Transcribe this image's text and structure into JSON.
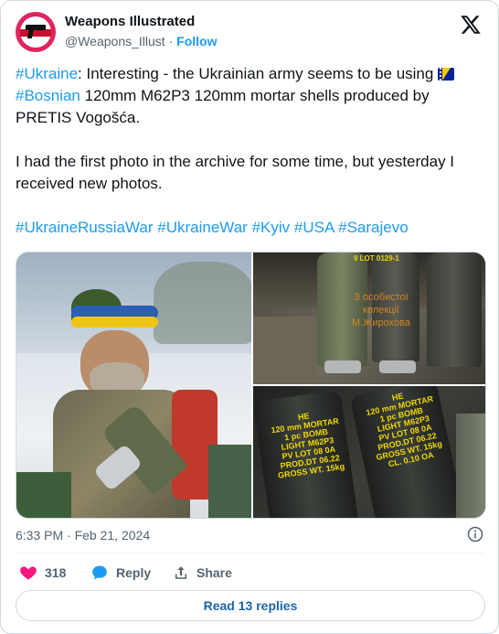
{
  "account": {
    "name": "Weapons Illustrated",
    "handle": "@Weapons_Illust",
    "separator": "·",
    "follow_label": "Follow",
    "avatar_icon": "pistol-logo-icon"
  },
  "brand_icon": "x-logo-icon",
  "tweet": {
    "tag_ukraine": "#Ukraine",
    "line1_rest": ": Interesting - the Ukrainian army seems to be using ",
    "flag_icon": "bosnia-flag-icon",
    "tag_bosnian": "#Bosnian",
    "line1_end": " 120mm M62P3 120mm mortar shells produced by PRETIS Vogošća.",
    "paragraph2": "I had the first photo in the archive for some time, but yesterday I received new photos.",
    "hashtags": [
      "#UkraineRussiaWar",
      "#UkraineWar",
      "#Kyiv",
      "#USA",
      "#Sarajevo"
    ]
  },
  "media": {
    "photo1": "soldier-with-mortar-shell-photo",
    "photo2": {
      "subject": "mortar-shells-photo",
      "watermark": "З особистої\nколекції\nМ.Жирохова",
      "shell_marking": "9 LOT 0129-1"
    },
    "photo3": {
      "subject": "mortar-shell-markings-photo",
      "marking_left": "HE\n120 mm MORTAR\n1 pc BOMB\nLIGHT M62P3\nPV LOT 08 0A\nPROD.DT 06.22\nGROSS WT. 15kg",
      "marking_right": "HE\n120 mm MORTAR\n1 pc BOMB\nLIGHT M62P3\nPV LOT 08 0A\nPROD.DT 06.22\nGROSS WT. 15kg\nCL. 0.10 OA"
    }
  },
  "meta": {
    "time": "6:33 PM",
    "separator": "·",
    "date": "Feb 21, 2024",
    "info_icon": "info-icon"
  },
  "actions": {
    "like_count": "318",
    "reply_label": "Reply",
    "share_label": "Share",
    "like_color": "#f91880",
    "reply_color": "#1d9bf0"
  },
  "read_replies_label": "Read 13 replies"
}
